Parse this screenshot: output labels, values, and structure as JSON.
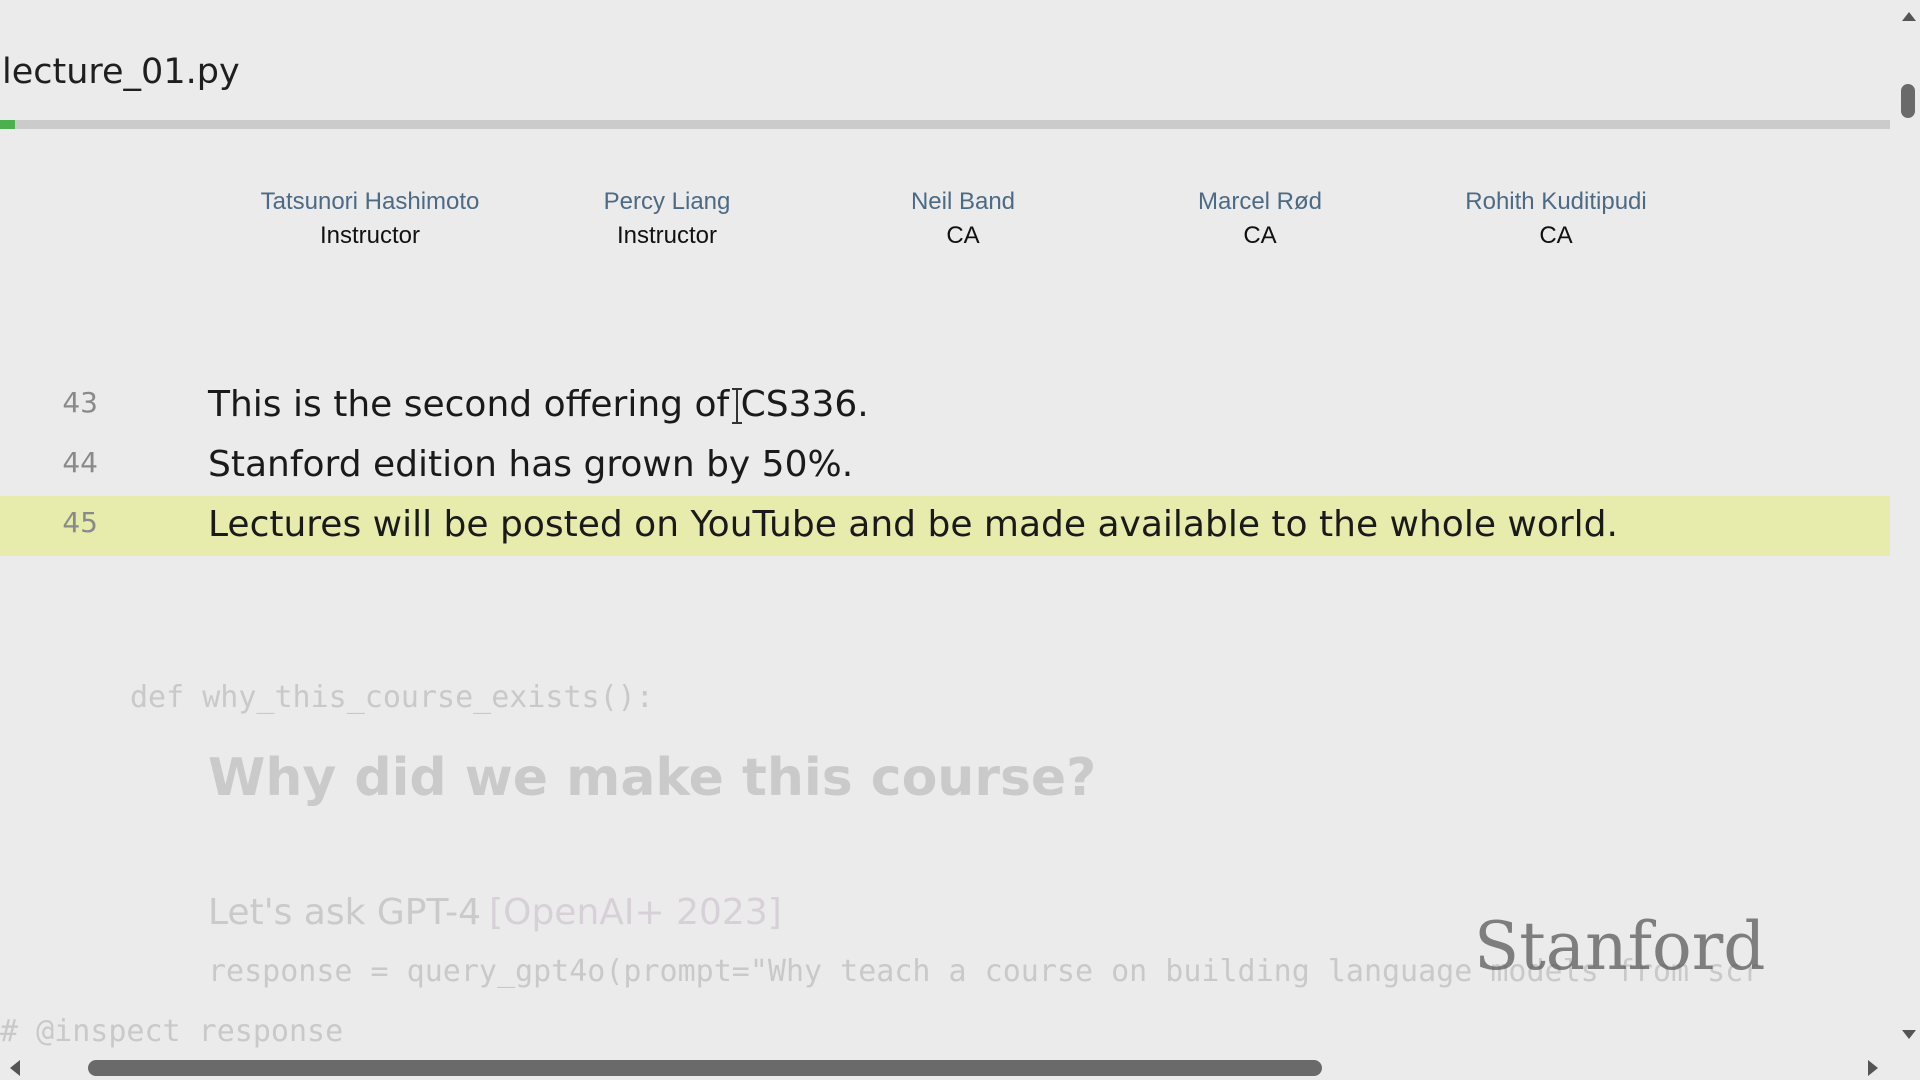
{
  "file": {
    "title": "lecture_01.py",
    "progress_percent": 0.8
  },
  "people": [
    {
      "name": "Tatsunori Hashimoto",
      "role": "Instructor"
    },
    {
      "name": "Percy Liang",
      "role": "Instructor"
    },
    {
      "name": "Neil Band",
      "role": "CA"
    },
    {
      "name": "Marcel Rød",
      "role": "CA"
    },
    {
      "name": "Rohith Kuditipudi",
      "role": "CA"
    }
  ],
  "lines": {
    "l43": {
      "num": "43",
      "text": "This is the second offering of CS336."
    },
    "l44": {
      "num": "44",
      "text": "Stanford edition has grown by 50%."
    },
    "l45": {
      "num": "45",
      "text": "Lectures will be posted on YouTube and be made available to the whole world."
    },
    "def_line": "def why_this_course_exists():",
    "heading": "Why did we make this course?",
    "ask": "Let's ask GPT-4",
    "ask_cite": "[OpenAI+ 2023]",
    "response_code": "response = query_gpt4o(prompt=\"Why teach a course on building language models from scr",
    "inspect_code": "# @inspect response"
  },
  "watermark": "Stanford",
  "colors": {
    "highlight": "#e7ebac",
    "progress": "#4caf50",
    "person_name": "#4d6a85"
  }
}
